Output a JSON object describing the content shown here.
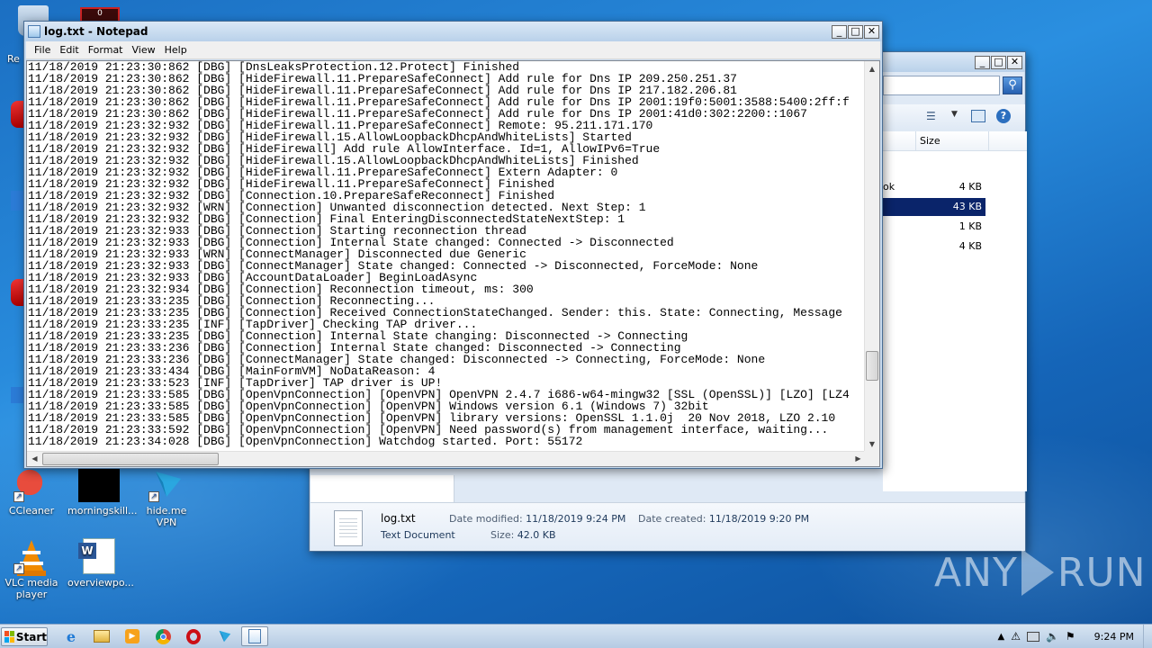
{
  "desktop": {
    "icons": [
      {
        "label": "CCleaner",
        "icon": "ccleaner-icon"
      },
      {
        "label": "morningskill...",
        "icon": "black-thumbnail-icon"
      },
      {
        "label": "hide.me VPN",
        "icon": "hideme-vpn-icon"
      },
      {
        "label": "VLC media player",
        "icon": "vlc-icon"
      },
      {
        "label": "overviewpo...",
        "icon": "word-document-icon"
      }
    ],
    "partial_labels": {
      "top_left": "Re",
      "recycle_counter": "0"
    }
  },
  "explorer": {
    "column_header": "Size",
    "files": [
      {
        "name": "ok",
        "size": "4 KB",
        "selected": false
      },
      {
        "name": "",
        "size": "43 KB",
        "selected": true
      },
      {
        "name": "",
        "size": "1 KB",
        "selected": false
      },
      {
        "name": "",
        "size": "4 KB",
        "selected": false
      }
    ],
    "details": {
      "filename": "log.txt",
      "type": "Text Document",
      "date_modified_label": "Date modified:",
      "date_modified": "11/18/2019 9:24 PM",
      "date_created_label": "Date created:",
      "date_created": "11/18/2019 9:20 PM",
      "size_label": "Size:",
      "size": "42.0 KB"
    }
  },
  "notepad": {
    "title": "log.txt - Notepad",
    "menu": [
      "File",
      "Edit",
      "Format",
      "View",
      "Help"
    ],
    "lines": [
      "11/18/2019 21:23:30:862 [DBG] [DnsLeaksProtection.12.Protect] Finished",
      "11/18/2019 21:23:30:862 [DBG] [HideFirewall.11.PrepareSafeConnect] Add rule for Dns IP 209.250.251.37",
      "11/18/2019 21:23:30:862 [DBG] [HideFirewall.11.PrepareSafeConnect] Add rule for Dns IP 217.182.206.81",
      "11/18/2019 21:23:30:862 [DBG] [HideFirewall.11.PrepareSafeConnect] Add rule for Dns IP 2001:19f0:5001:3588:5400:2ff:f",
      "11/18/2019 21:23:30:862 [DBG] [HideFirewall.11.PrepareSafeConnect] Add rule for Dns IP 2001:41d0:302:2200::1067",
      "11/18/2019 21:23:32:932 [DBG] [HideFirewall.11.PrepareSafeConnect] Remote: 95.211.171.170",
      "11/18/2019 21:23:32:932 [DBG] [HideFirewall.15.AllowLoopbackDhcpAndWhiteLists] Started",
      "11/18/2019 21:23:32:932 [DBG] [HideFirewall] Add rule AllowInterface. Id=1, AllowIPv6=True",
      "11/18/2019 21:23:32:932 [DBG] [HideFirewall.15.AllowLoopbackDhcpAndWhiteLists] Finished",
      "11/18/2019 21:23:32:932 [DBG] [HideFirewall.11.PrepareSafeConnect] Extern Adapter: 0",
      "11/18/2019 21:23:32:932 [DBG] [HideFirewall.11.PrepareSafeConnect] Finished",
      "11/18/2019 21:23:32:932 [DBG] [Connection.10.PrepareSafeReconnect] Finished",
      "11/18/2019 21:23:32:932 [WRN] [Connection] Unwanted disconnection detected. Next Step: 1",
      "11/18/2019 21:23:32:932 [DBG] [Connection] Final EnteringDisconnectedStateNextStep: 1",
      "11/18/2019 21:23:32:933 [DBG] [Connection] Starting reconnection thread",
      "11/18/2019 21:23:32:933 [DBG] [Connection] Internal State changed: Connected -> Disconnected",
      "11/18/2019 21:23:32:933 [WRN] [ConnectManager] Disconnected due Generic",
      "11/18/2019 21:23:32:933 [DBG] [ConnectManager] State changed: Connected -> Disconnected, ForceMode: None",
      "11/18/2019 21:23:32:933 [DBG] [AccountDataLoader] BeginLoadAsync",
      "11/18/2019 21:23:32:934 [DBG] [Connection] Reconnection timeout, ms: 300",
      "11/18/2019 21:23:33:235 [DBG] [Connection] Reconnecting...",
      "11/18/2019 21:23:33:235 [DBG] [Connection] Received ConnectionStateChanged. Sender: this. State: Connecting, Message",
      "11/18/2019 21:23:33:235 [INF] [TapDriver] Checking TAP driver...",
      "11/18/2019 21:23:33:235 [DBG] [Connection] Internal State changing: Disconnected -> Connecting",
      "11/18/2019 21:23:33:236 [DBG] [Connection] Internal State changed: Disconnected -> Connecting",
      "11/18/2019 21:23:33:236 [DBG] [ConnectManager] State changed: Disconnected -> Connecting, ForceMode: None",
      "11/18/2019 21:23:33:434 [DBG] [MainFormVM] NoDataReason: 4",
      "11/18/2019 21:23:33:523 [INF] [TapDriver] TAP driver is UP!",
      "11/18/2019 21:23:33:585 [DBG] [OpenVpnConnection] [OpenVPN] OpenVPN 2.4.7 i686-w64-mingw32 [SSL (OpenSSL)] [LZO] [LZ4",
      "11/18/2019 21:23:33:585 [DBG] [OpenVpnConnection] [OpenVPN] Windows version 6.1 (Windows 7) 32bit",
      "11/18/2019 21:23:33:585 [DBG] [OpenVpnConnection] [OpenVPN] library versions: OpenSSL 1.1.0j  20 Nov 2018, LZO 2.10",
      "11/18/2019 21:23:33:592 [DBG] [OpenVpnConnection] [OpenVPN] Need password(s) from management interface, waiting...",
      "11/18/2019 21:23:34:028 [DBG] [OpenVpnConnection] Watchdog started. Port: 55172"
    ]
  },
  "watermark": {
    "text_left": "ANY",
    "text_right": "RUN"
  },
  "taskbar": {
    "start_label": "Start",
    "clock": "9:24 PM",
    "pinned": [
      "internet-explorer-icon",
      "file-explorer-icon",
      "media-player-icon",
      "chrome-icon",
      "opera-icon",
      "hideme-vpn-icon",
      "notepad-icon"
    ],
    "active_item": "notepad-icon"
  },
  "colors": {
    "selection": "#0a246a",
    "desktop_blue": "#1b6fc2"
  }
}
